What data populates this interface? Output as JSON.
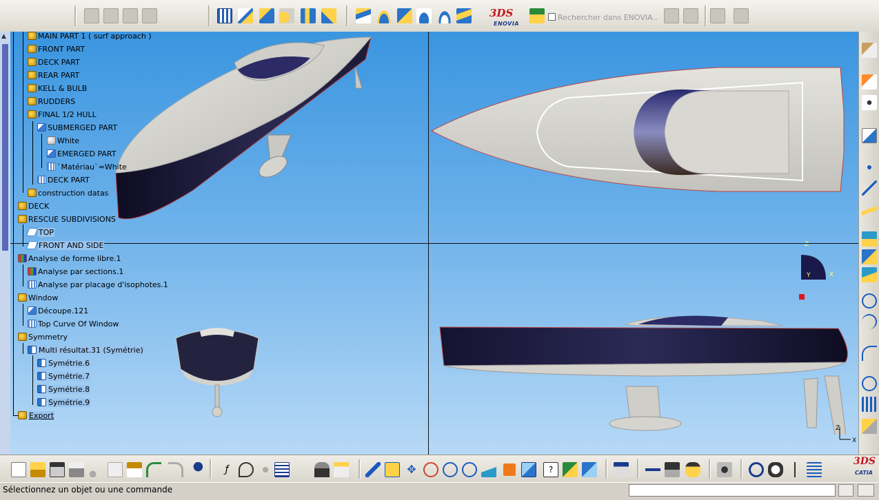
{
  "search": {
    "placeholder": "Rechercher dans ENOVIA..."
  },
  "logos": {
    "top_brand": "ENOVIA",
    "top_mark": "3DS",
    "bottom_brand": "CATIA",
    "bottom_mark": "3DS"
  },
  "tree": {
    "items": [
      {
        "label": "MAIN PART 1 ( surf approach )",
        "icon": "part-body-icon"
      },
      {
        "label": "FRONT PART",
        "icon": "part-body-icon"
      },
      {
        "label": "DECK PART",
        "icon": "part-body-icon"
      },
      {
        "label": "REAR PART",
        "icon": "part-body-icon"
      },
      {
        "label": "KELL & BULB",
        "icon": "part-body-icon"
      },
      {
        "label": "RUDDERS",
        "icon": "part-body-icon"
      },
      {
        "label": "FINAL 1/2 HULL",
        "icon": "part-body-icon"
      },
      {
        "label": "SUBMERGED PART",
        "icon": "surface-icon"
      },
      {
        "label": "White",
        "icon": "material-sphere-icon"
      },
      {
        "label": "EMERGED PART",
        "icon": "surface-icon"
      },
      {
        "label": "`Matériau`=White",
        "icon": "parameter-icon"
      },
      {
        "label": "DECK PART",
        "icon": "surface-grid-icon"
      },
      {
        "label": "construction datas",
        "icon": "part-body-icon"
      },
      {
        "label": "DECK",
        "icon": "part-body-icon"
      },
      {
        "label": "RESCUE SUBDIVISIONS",
        "icon": "part-body-icon"
      },
      {
        "label": "TOP",
        "icon": "plane-icon"
      },
      {
        "label": "FRONT AND SIDE",
        "icon": "plane-icon"
      },
      {
        "label": "Analyse de forme libre.1",
        "icon": "analysis-icon"
      },
      {
        "label": "Analyse par sections.1",
        "icon": "section-analysis-icon"
      },
      {
        "label": "Analyse par placage d'isophotes.1",
        "icon": "isophote-analysis-icon"
      },
      {
        "label": "Window",
        "icon": "part-body-icon"
      },
      {
        "label": "Découpe.121",
        "icon": "split-icon"
      },
      {
        "label": "Top Curve Of Window",
        "icon": "curve-grid-icon"
      },
      {
        "label": "Symmetry",
        "icon": "part-body-icon"
      },
      {
        "label": "Multi résultat.31 (Symétrie)",
        "icon": "multi-result-icon"
      },
      {
        "label": "Symétrie.6",
        "icon": "symmetry-icon"
      },
      {
        "label": "Symétrie.7",
        "icon": "symmetry-icon"
      },
      {
        "label": "Symétrie.8",
        "icon": "symmetry-icon"
      },
      {
        "label": "Symétrie.9",
        "icon": "symmetry-icon"
      },
      {
        "label": "Export",
        "icon": "part-body-icon"
      }
    ]
  },
  "compass": {
    "z": "Z",
    "y": "Y",
    "x": "X"
  },
  "axes": {
    "z": "Z",
    "x": "X"
  },
  "status": {
    "message": "Sélectionnez un objet ou une commande"
  },
  "colors": {
    "hull_dark": "#1c1a3a",
    "hull_light": "#d9d8d2",
    "viewport_top": "#3a95e0",
    "viewport_bottom": "#b7d9f6",
    "selection": "#99c4ee"
  }
}
